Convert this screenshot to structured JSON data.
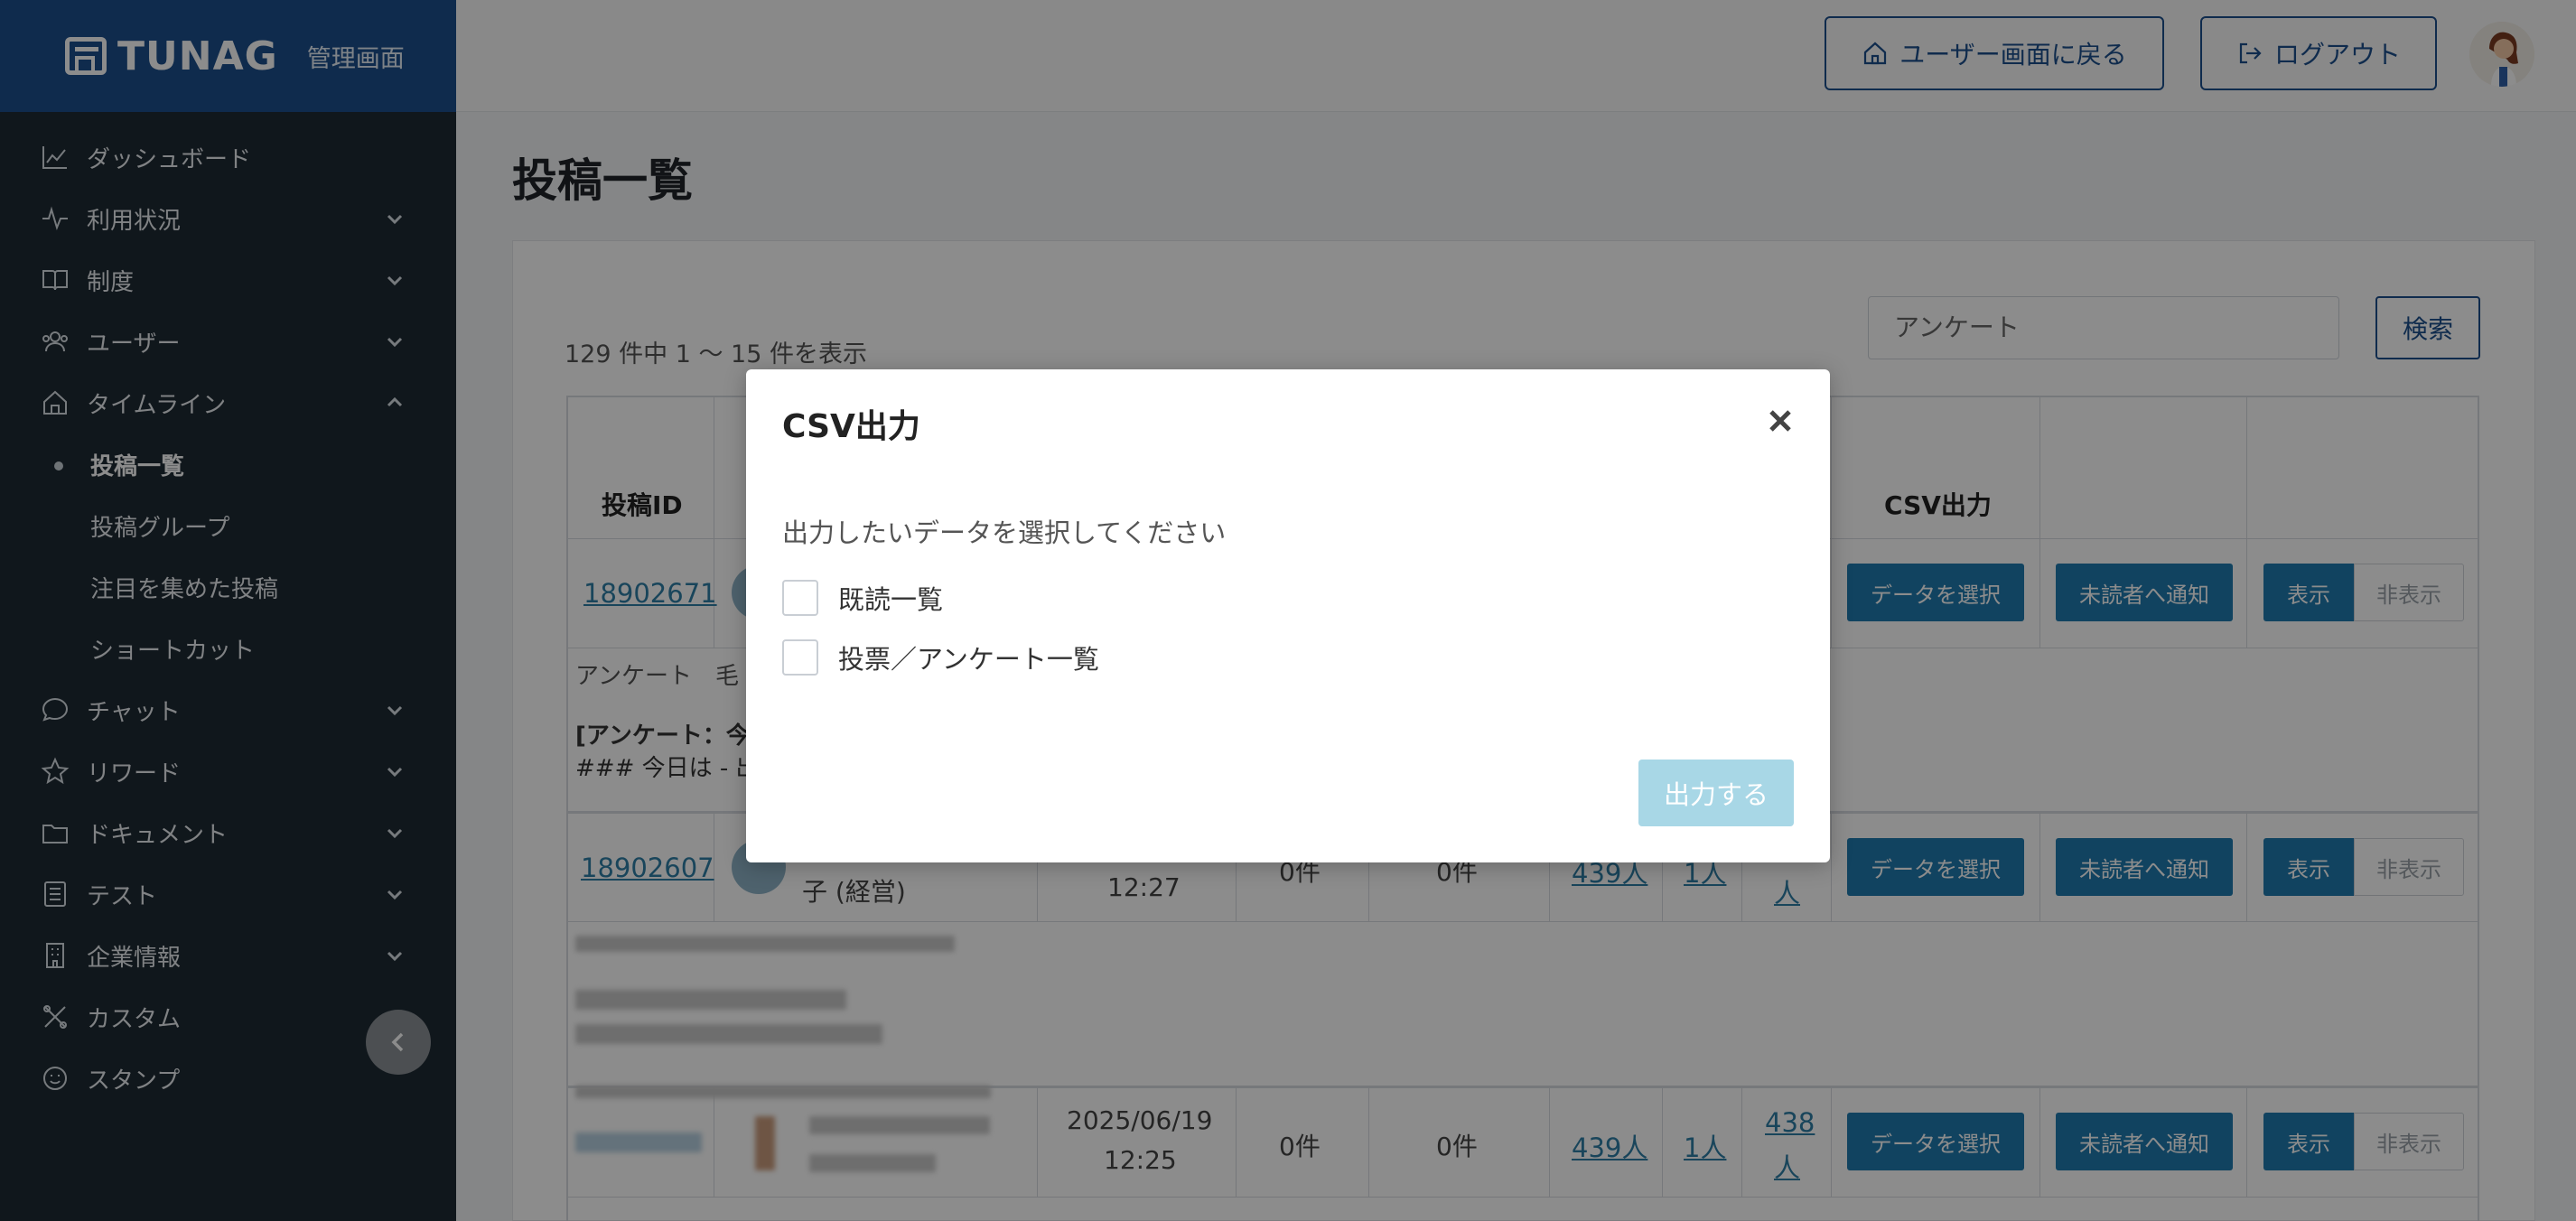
{
  "brand": {
    "name": "TUNAG",
    "subtitle": "管理画面"
  },
  "sidebar": {
    "items": [
      {
        "label": "ダッシュボード"
      },
      {
        "label": "利用状況"
      },
      {
        "label": "制度"
      },
      {
        "label": "ユーザー"
      },
      {
        "label": "タイムライン"
      },
      {
        "label": "チャット"
      },
      {
        "label": "リワード"
      },
      {
        "label": "ドキュメント"
      },
      {
        "label": "テスト"
      },
      {
        "label": "企業情報"
      },
      {
        "label": "カスタム"
      },
      {
        "label": "スタンプ"
      }
    ],
    "timeline_subitems": [
      {
        "label": "投稿一覧"
      },
      {
        "label": "投稿グループ"
      },
      {
        "label": "注目を集めた投稿"
      },
      {
        "label": "ショートカット"
      }
    ]
  },
  "topbar": {
    "back_label": "ユーザー画面に戻る",
    "logout_label": "ログアウト"
  },
  "page": {
    "title": "投稿一覧",
    "count_text": "129 件中 1 〜 15 件を表示",
    "search_value": "アンケート",
    "search_button": "検索"
  },
  "table": {
    "headers": {
      "post_id": "投稿ID",
      "csv": "CSV出力"
    },
    "rows": [
      {
        "id": "18902671",
        "body_tag": "アンケート　毛",
        "body_line1": "[アンケート：今",
        "body_line2": "### 今日は - 出",
        "select_label": "データを選択",
        "notify_label": "未読者へ通知",
        "show_label": "表示",
        "hide_label": "非表示"
      },
      {
        "id": "18902607",
        "author_suffix": "子 (経営)",
        "time": "12:27",
        "comments": "0件",
        "likes": "0件",
        "read": "439人",
        "reactions": "1人",
        "unread": "人",
        "select_label": "データを選択",
        "notify_label": "未読者へ通知",
        "show_label": "表示",
        "hide_label": "非表示"
      },
      {
        "date": "2025/06/19",
        "time": "12:25",
        "comments": "0件",
        "likes": "0件",
        "read": "439人",
        "reactions": "1人",
        "unread_line1": "438",
        "unread_line2": "人",
        "select_label": "データを選択",
        "notify_label": "未読者へ通知",
        "show_label": "表示",
        "hide_label": "非表示"
      }
    ]
  },
  "modal": {
    "title": "CSV出力",
    "description": "出力したいデータを選択してください",
    "options": [
      {
        "label": "既読一覧",
        "checked": false
      },
      {
        "label": "投票／アンケート一覧",
        "checked": false
      }
    ],
    "submit_label": "出力する"
  }
}
